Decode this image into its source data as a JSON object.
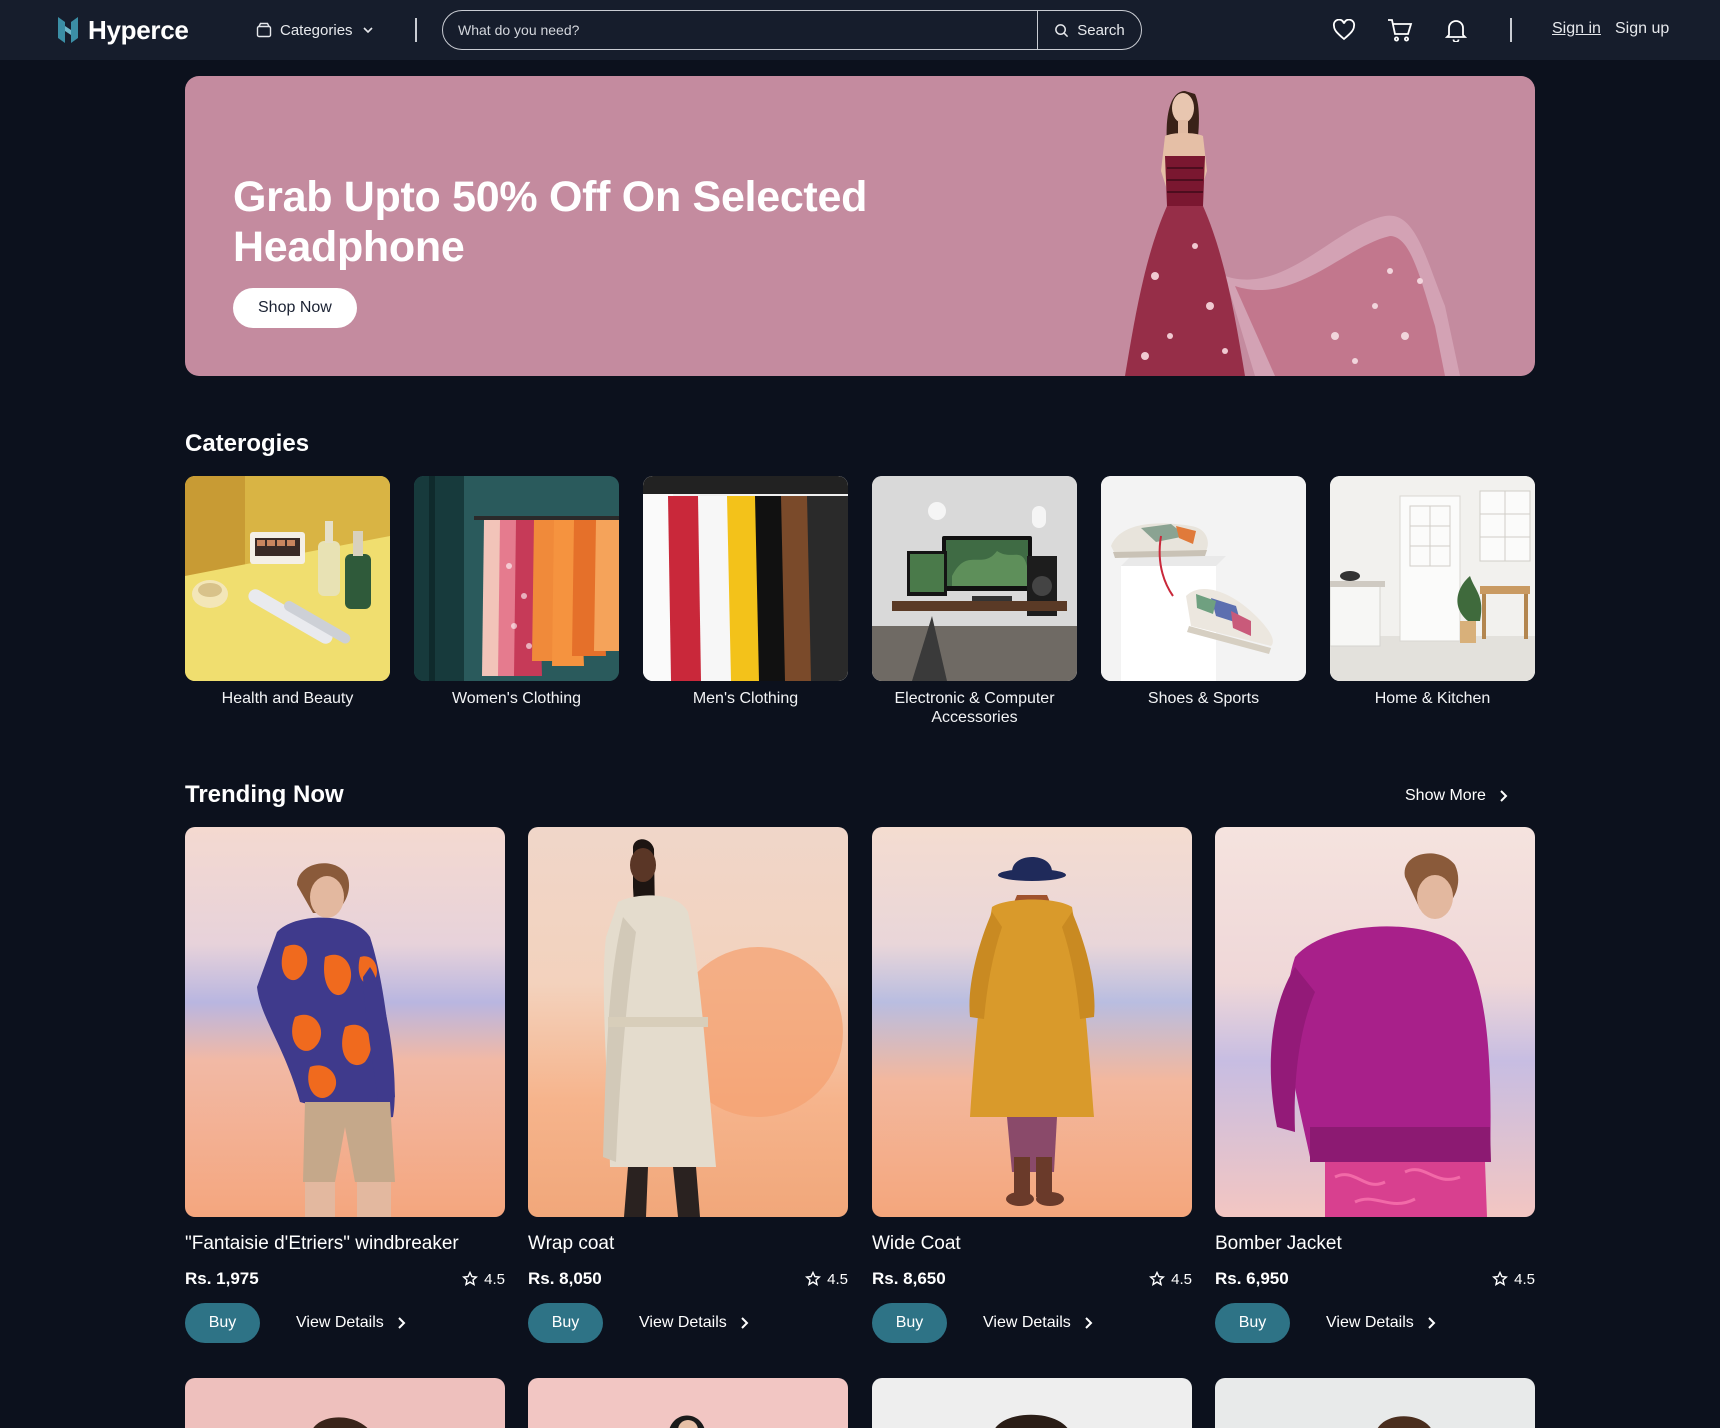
{
  "header": {
    "brand": "Hyperce",
    "categories_label": "Categories",
    "search_placeholder": "What do you need?",
    "search_button": "Search",
    "sign_in": "Sign in",
    "sign_up": "Sign up",
    "icons": [
      "wishlist-heart-icon",
      "cart-icon",
      "notification-bell-icon"
    ]
  },
  "hero": {
    "title": "Grab Upto 50% Off On Selected Headphone",
    "cta": "Shop Now",
    "background": "#c48b9f"
  },
  "categories_section": {
    "title": "Caterogies",
    "items": [
      {
        "label": "Health and Beauty"
      },
      {
        "label": "Women's Clothing"
      },
      {
        "label": "Men's Clothing"
      },
      {
        "label": "Electronic & Computer Accessories"
      },
      {
        "label": "Shoes & Sports"
      },
      {
        "label": "Home & Kitchen"
      }
    ]
  },
  "trending": {
    "title": "Trending Now",
    "show_more": "Show More",
    "products": [
      {
        "name": "\"Fantaisie d'Etriers\" windbreaker",
        "price": "Rs. 1,975",
        "rating": "4.5",
        "buy": "Buy",
        "details": "View Details"
      },
      {
        "name": "Wrap coat",
        "price": "Rs. 8,050",
        "rating": "4.5",
        "buy": "Buy",
        "details": "View Details"
      },
      {
        "name": "Wide Coat",
        "price": "Rs. 8,650",
        "rating": "4.5",
        "buy": "Buy",
        "details": "View Details"
      },
      {
        "name": "Bomber Jacket",
        "price": "Rs. 6,950",
        "rating": "4.5",
        "buy": "Buy",
        "details": "View Details"
      }
    ]
  },
  "colors": {
    "page_bg": "#0c111d",
    "header_bg": "#161d2c",
    "accent": "#2e7386"
  }
}
